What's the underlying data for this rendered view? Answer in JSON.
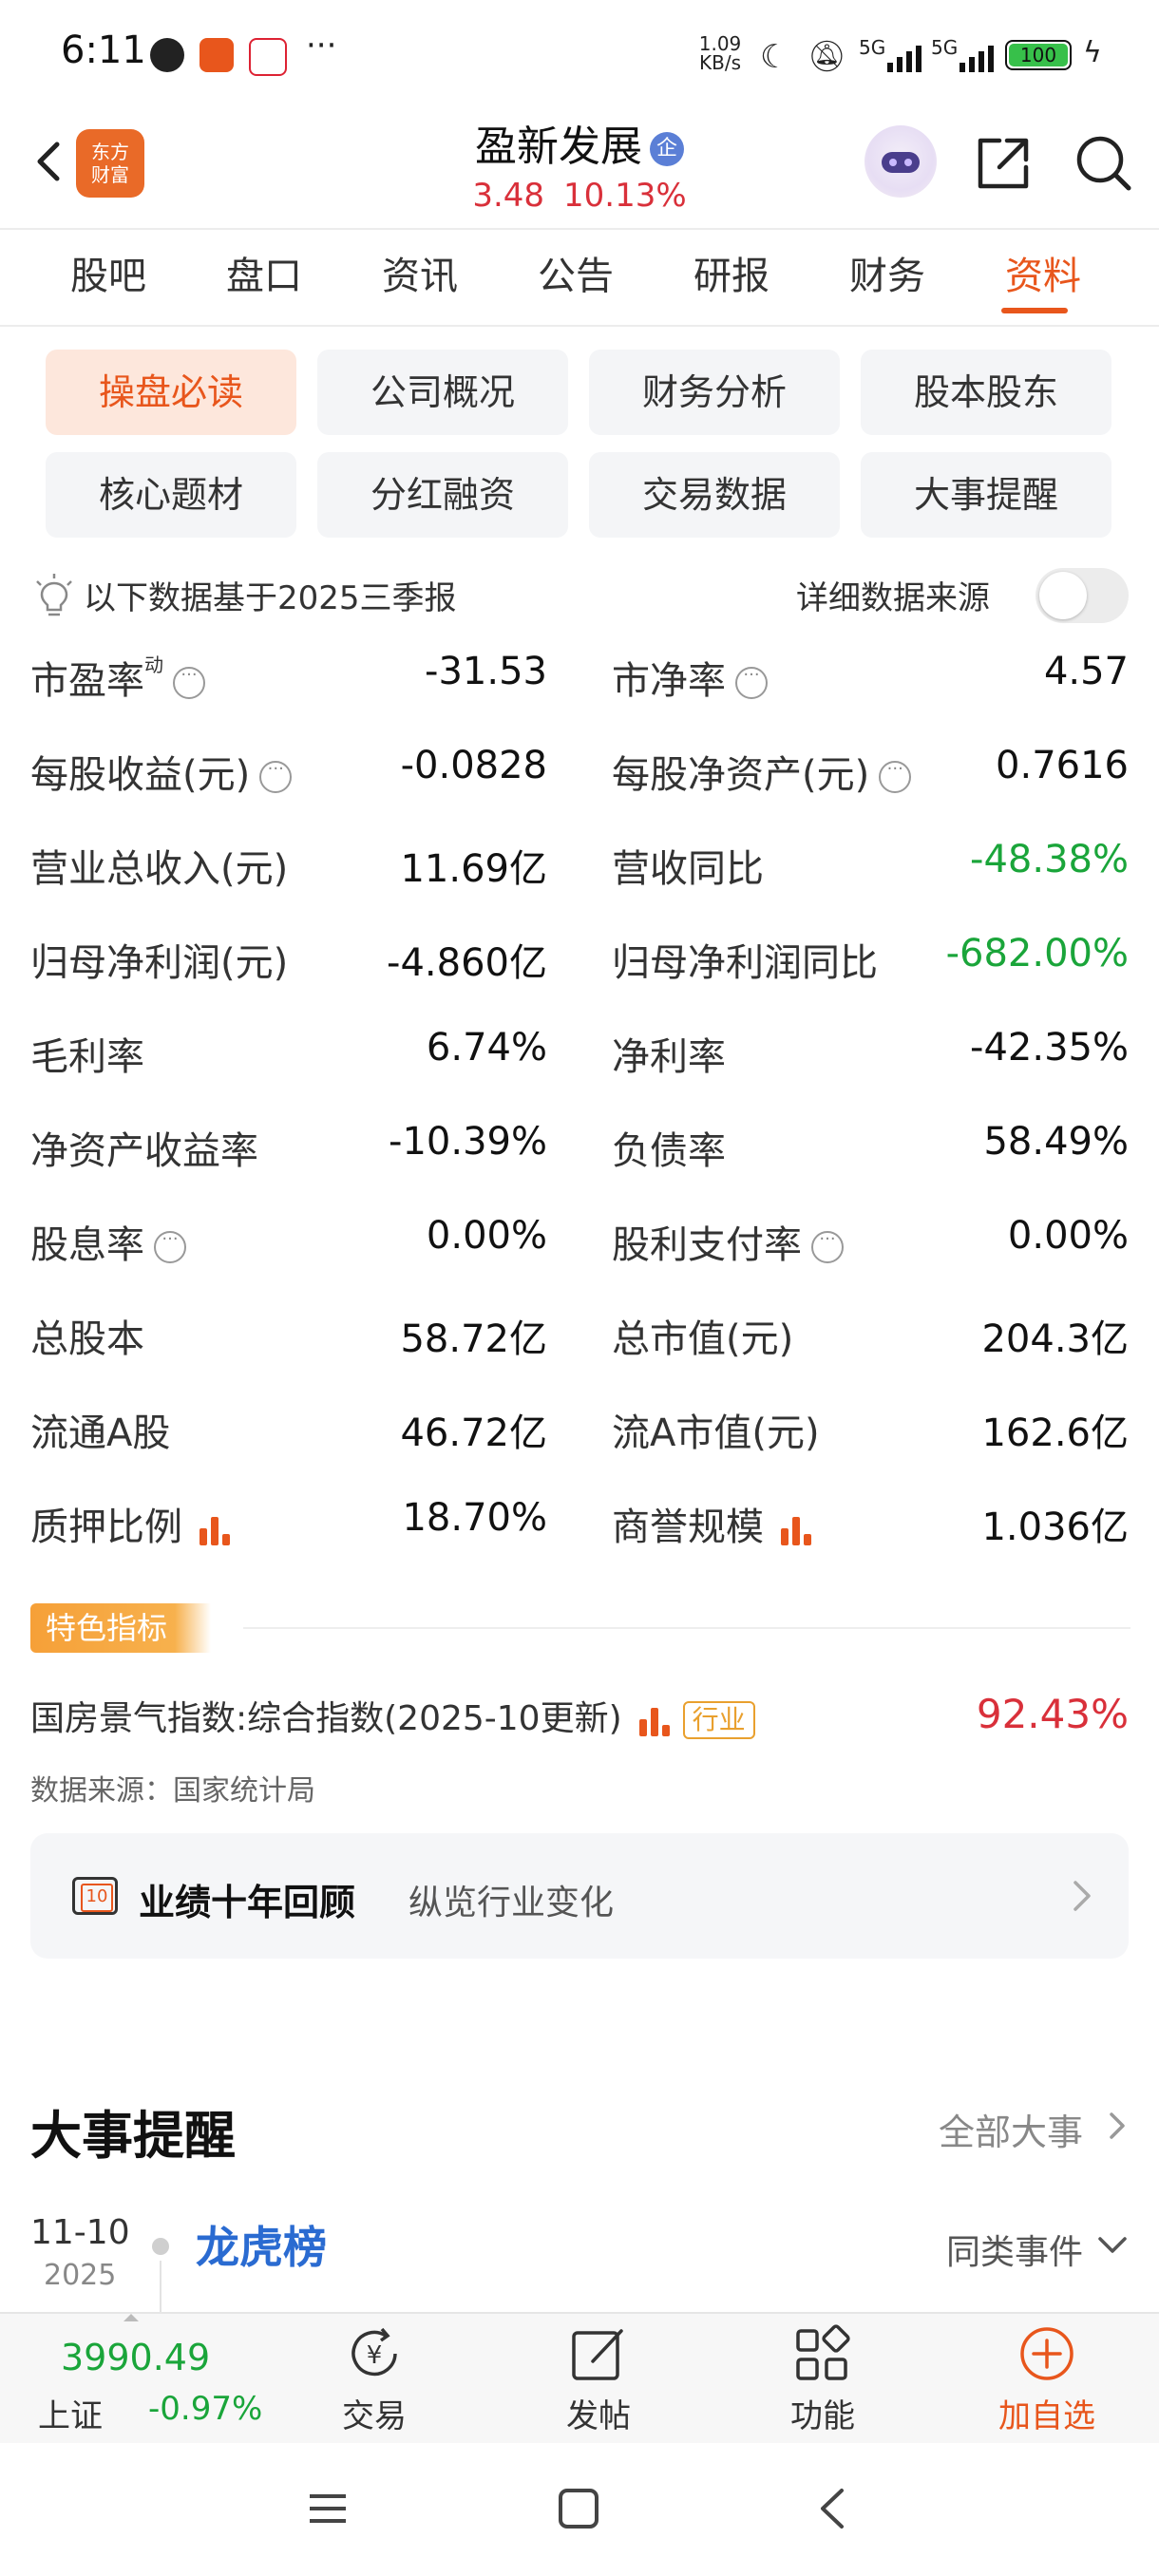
{
  "status": {
    "time": "6:11",
    "net_speed": "1.09 KB/s",
    "signal": "5G",
    "battery": "100"
  },
  "header": {
    "brand_logo": "东方财富",
    "stock_name": "盈新发展",
    "badge": "企",
    "price": "3.48",
    "change_pct": "10.13%"
  },
  "tabs": [
    "股吧",
    "盘口",
    "资讯",
    "公告",
    "研报",
    "财务",
    "资料"
  ],
  "active_tab": "资料",
  "chips": [
    "操盘必读",
    "公司概况",
    "财务分析",
    "股本股东",
    "核心题材",
    "分红融资",
    "交易数据",
    "大事提醒"
  ],
  "note": {
    "text": "以下数据基于2025三季报",
    "source_toggle": "详细数据来源"
  },
  "metrics": [
    {
      "label": "市盈率",
      "sup": "动",
      "info": true,
      "value": "-31.53"
    },
    {
      "label": "市净率",
      "info": true,
      "value": "4.57"
    },
    {
      "label": "每股收益(元)",
      "info": true,
      "value": "-0.0828"
    },
    {
      "label": "每股净资产(元)",
      "info": true,
      "value": "0.7616"
    },
    {
      "label": "营业总收入(元)",
      "value": "11.69亿"
    },
    {
      "label": "营收同比",
      "value": "-48.38%",
      "color": "green"
    },
    {
      "label": "归母净利润(元)",
      "value": "-4.860亿"
    },
    {
      "label": "归母净利润同比",
      "value": "-682.00%",
      "color": "green"
    },
    {
      "label": "毛利率",
      "value": "6.74%"
    },
    {
      "label": "净利率",
      "value": "-42.35%"
    },
    {
      "label": "净资产收益率",
      "value": "-10.39%"
    },
    {
      "label": "负债率",
      "value": "58.49%"
    },
    {
      "label": "股息率",
      "info": true,
      "value": "0.00%"
    },
    {
      "label": "股利支付率",
      "info": true,
      "value": "0.00%"
    },
    {
      "label": "总股本",
      "value": "58.72亿"
    },
    {
      "label": "总市值(元)",
      "value": "204.3亿"
    },
    {
      "label": "流通A股",
      "value": "46.72亿"
    },
    {
      "label": "流A市值(元)",
      "value": "162.6亿"
    },
    {
      "label": "质押比例",
      "bars": true,
      "value": "18.70%"
    },
    {
      "label": "商誉规模",
      "bars": true,
      "value": "1.036亿"
    }
  ],
  "feature": {
    "tag": "特色指标",
    "index_label": "国房景气指数:综合指数(2025-10更新)",
    "industry_tag": "行业",
    "index_value": "92.43%",
    "source": "数据来源：国家统计局"
  },
  "review": {
    "icon_text": "10",
    "title": "业绩十年回顾",
    "subtitle": "纵览行业变化"
  },
  "events": {
    "title": "大事提醒",
    "all_label": "全部大事",
    "item": {
      "date": "11-10",
      "year": "2025",
      "title": "龙虎榜",
      "same_type": "同类事件"
    }
  },
  "bottom": {
    "index_value": "3990.49",
    "index_name": "上证",
    "index_change": "-0.97%",
    "nav": [
      {
        "label": "交易",
        "icon": "yen-exchange-icon"
      },
      {
        "label": "发帖",
        "icon": "edit-icon"
      },
      {
        "label": "功能",
        "icon": "grid-icon"
      },
      {
        "label": "加自选",
        "icon": "plus-circle-icon"
      }
    ]
  },
  "colors": {
    "accent": "#e8561c",
    "up": "#d9303a",
    "down": "#1aa53a"
  }
}
